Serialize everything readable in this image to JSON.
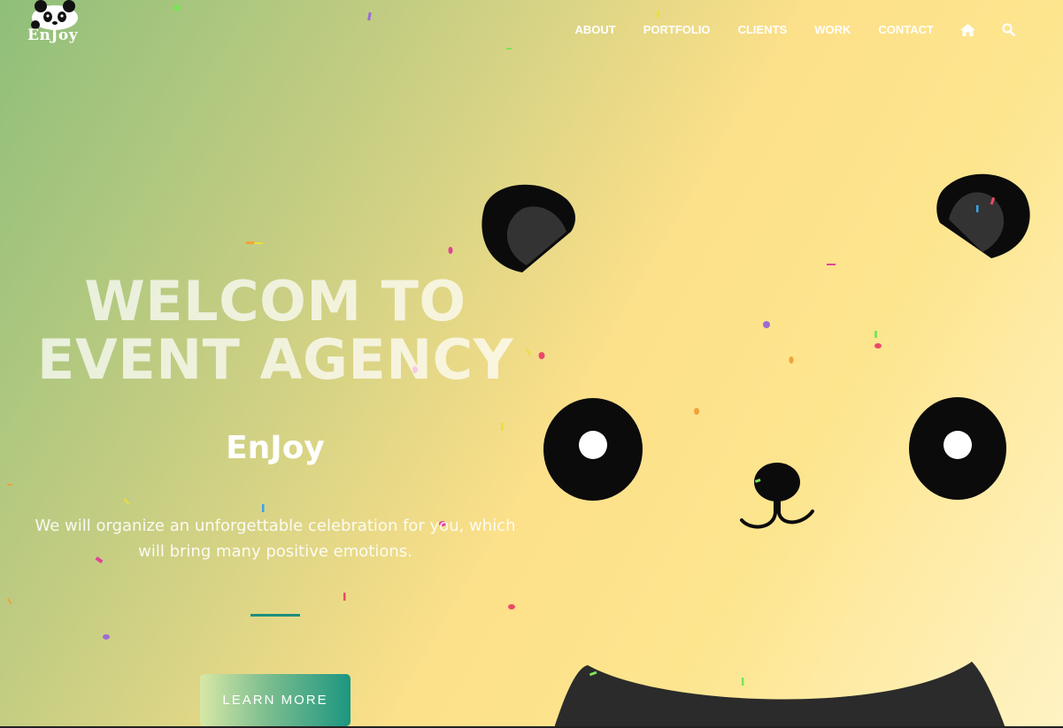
{
  "brand": {
    "name": "EnJoy"
  },
  "nav": {
    "items": [
      "ABOUT",
      "PORTFOLIO",
      "CLIENTS",
      "WORK",
      "CONTACT"
    ],
    "icons": [
      "home-icon",
      "search-icon"
    ]
  },
  "hero": {
    "headline_line1": "WELCOM TO",
    "headline_line2": "EVENT AGENCY",
    "subtitle": "EnJoy",
    "tagline": "We will organize an unforgettable celebration for you, which will bring many positive emotions.",
    "button_label": "LEARN MORE"
  },
  "colors": {
    "accent": "#1c9680",
    "panda_black": "#0b0b0b",
    "panda_ear": "#2c2c2c"
  }
}
